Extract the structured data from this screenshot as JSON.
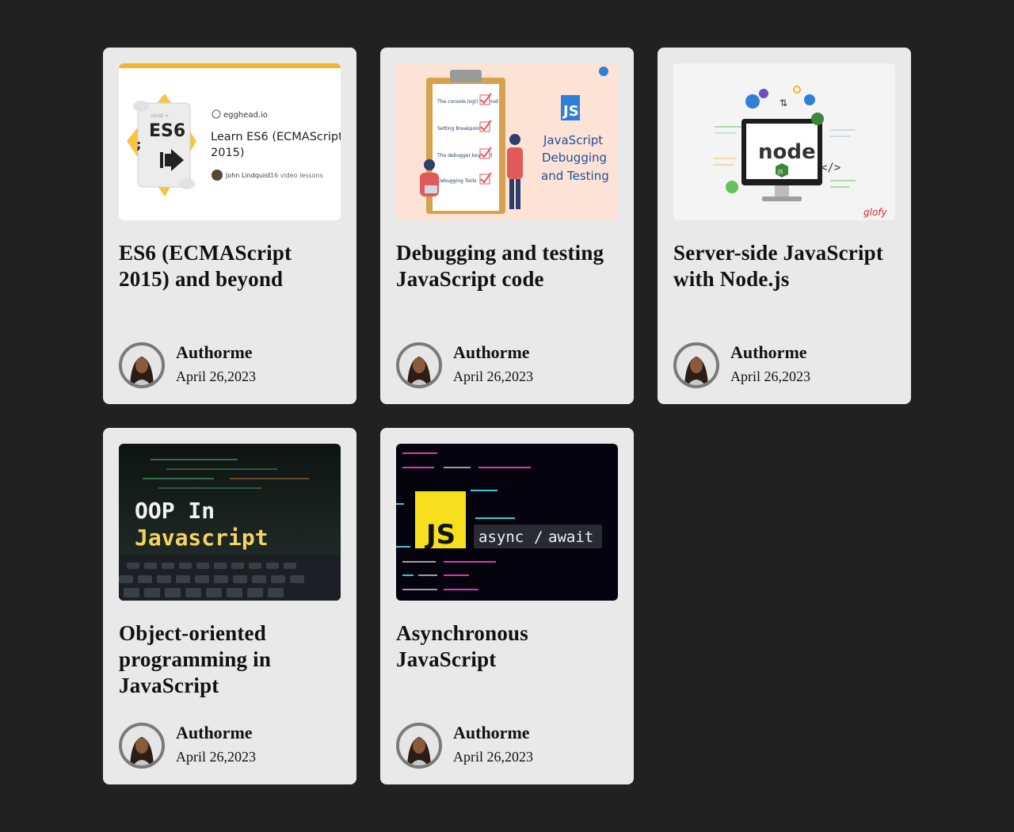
{
  "cards": [
    {
      "title": "ES6 (ECMAScript 2015) and beyond",
      "author": "Authorme",
      "date": "April 26,2023",
      "thumb": {
        "badge": "ES6",
        "brand": "egghead.io",
        "heading_line1": "Learn ES6 (ECMAScript",
        "heading_line2": "2015)",
        "instructor": "John Lindquist",
        "lessons": "16 video lessons",
        "accent": "#f6b233"
      }
    },
    {
      "title": "Debugging and testing JavaScript code",
      "author": "Authorme",
      "date": "April 26,2023",
      "thumb": {
        "items": [
          "The console.log() method",
          "Setting Breakpoints",
          "The debugger keyword",
          "Debugging Tools"
        ],
        "badge": "JS",
        "line1": "JavaScript",
        "line2": "Debugging",
        "line3": "and Testing",
        "accent": "#2f7fd6"
      }
    },
    {
      "title": "Server-side JavaScript with Node.js",
      "author": "Authorme",
      "date": "April 26,2023",
      "thumb": {
        "logo": "node",
        "badge": "JS",
        "brand": "glofy",
        "accent": "#3c873a"
      }
    },
    {
      "title": "Object-oriented programming in JavaScript",
      "author": "Authorme",
      "date": "April 26,2023",
      "thumb": {
        "line1": "OOP In",
        "line2": "Javascript",
        "accent": "#f4d35e"
      }
    },
    {
      "title": "Asynchronous JavaScript",
      "author": "Authorme",
      "date": "April 26,2023",
      "thumb": {
        "badge": "JS",
        "word1": "async",
        "sep": "/",
        "word2": "await",
        "accent": "#f7df1e"
      }
    }
  ]
}
